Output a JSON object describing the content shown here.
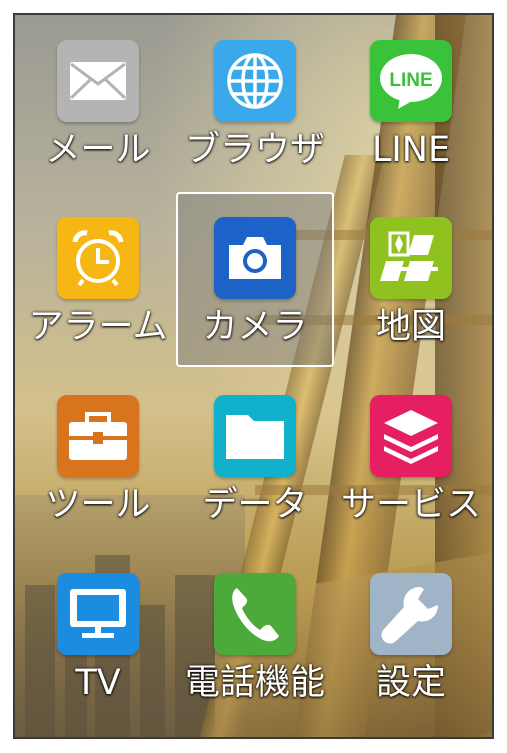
{
  "apps": [
    {
      "label": "メール",
      "icon": "mail-icon",
      "color": "#b4b4b4"
    },
    {
      "label": "ブラウザ",
      "icon": "globe-icon",
      "color": "#3aa9ec"
    },
    {
      "label": "LINE",
      "icon": "line-icon",
      "color": "#39c23a",
      "icon_text": "LINE"
    },
    {
      "label": "アラーム",
      "icon": "alarm-clock-icon",
      "color": "#f6b714"
    },
    {
      "label": "カメラ",
      "icon": "camera-icon",
      "color": "#1d62c6",
      "selected": true
    },
    {
      "label": "地図",
      "icon": "map-icon",
      "color": "#8fc21f"
    },
    {
      "label": "ツール",
      "icon": "toolbox-icon",
      "color": "#d9741e"
    },
    {
      "label": "データ",
      "icon": "folder-icon",
      "color": "#11b1cc"
    },
    {
      "label": "サービス",
      "icon": "layers-icon",
      "color": "#e51f62"
    },
    {
      "label": "TV",
      "icon": "tv-icon",
      "color": "#1c8ce0"
    },
    {
      "label": "電話機能",
      "icon": "phone-icon",
      "color": "#4caa3b"
    },
    {
      "label": "設定",
      "icon": "wrench-icon",
      "color": "#9fb4c6"
    }
  ]
}
